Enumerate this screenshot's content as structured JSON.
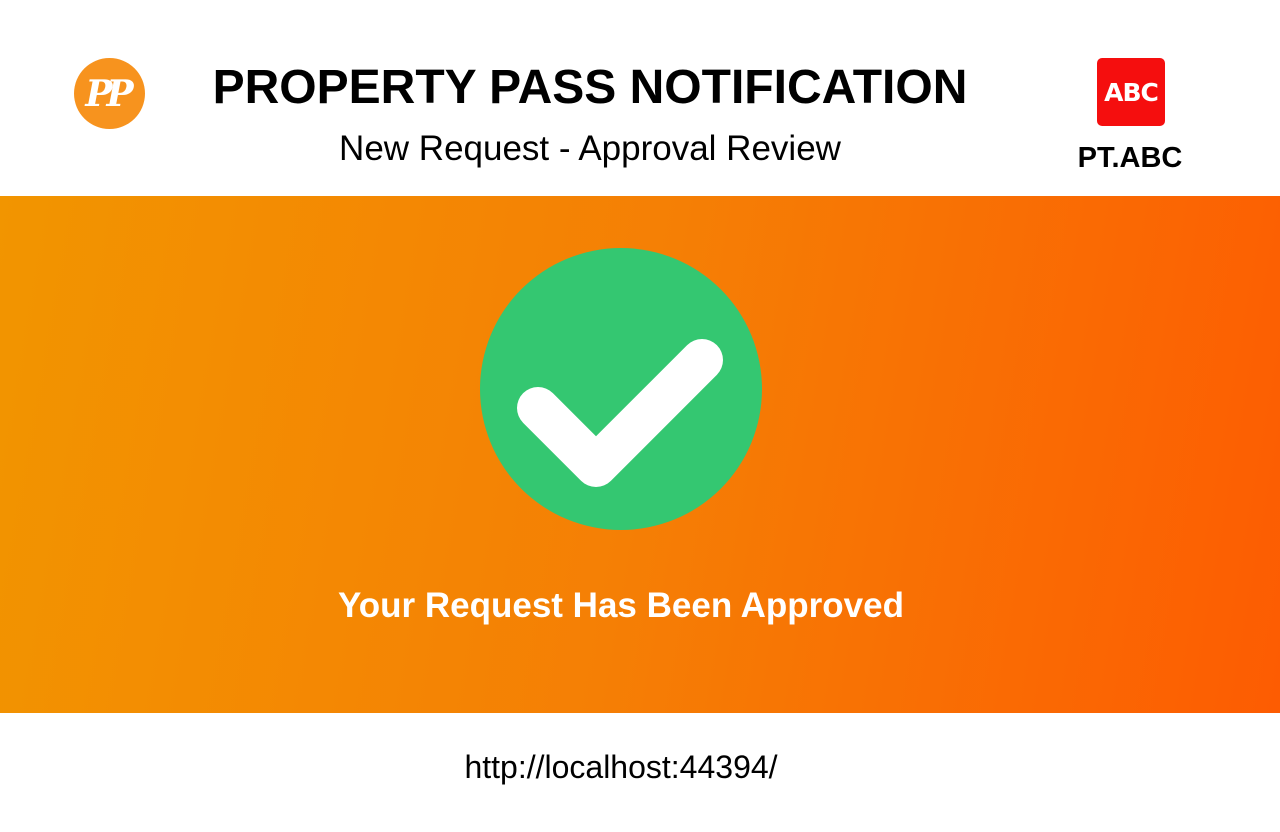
{
  "header": {
    "logo_text": "PP",
    "title": "PROPERTY PASS NOTIFICATION",
    "subtitle": "New Request - Approval Review",
    "company_logo_text": "ABC",
    "company_name": "PT.ABC"
  },
  "banner": {
    "status_icon": "check-circle-icon",
    "message": "Your Request Has Been Approved"
  },
  "footer": {
    "url": "http://localhost:44394/"
  },
  "colors": {
    "brand_orange": "#f7931e",
    "banner_start": "#f29500",
    "banner_end": "#fd5c02",
    "success_green": "#34c771",
    "company_red": "#f50e0e"
  }
}
